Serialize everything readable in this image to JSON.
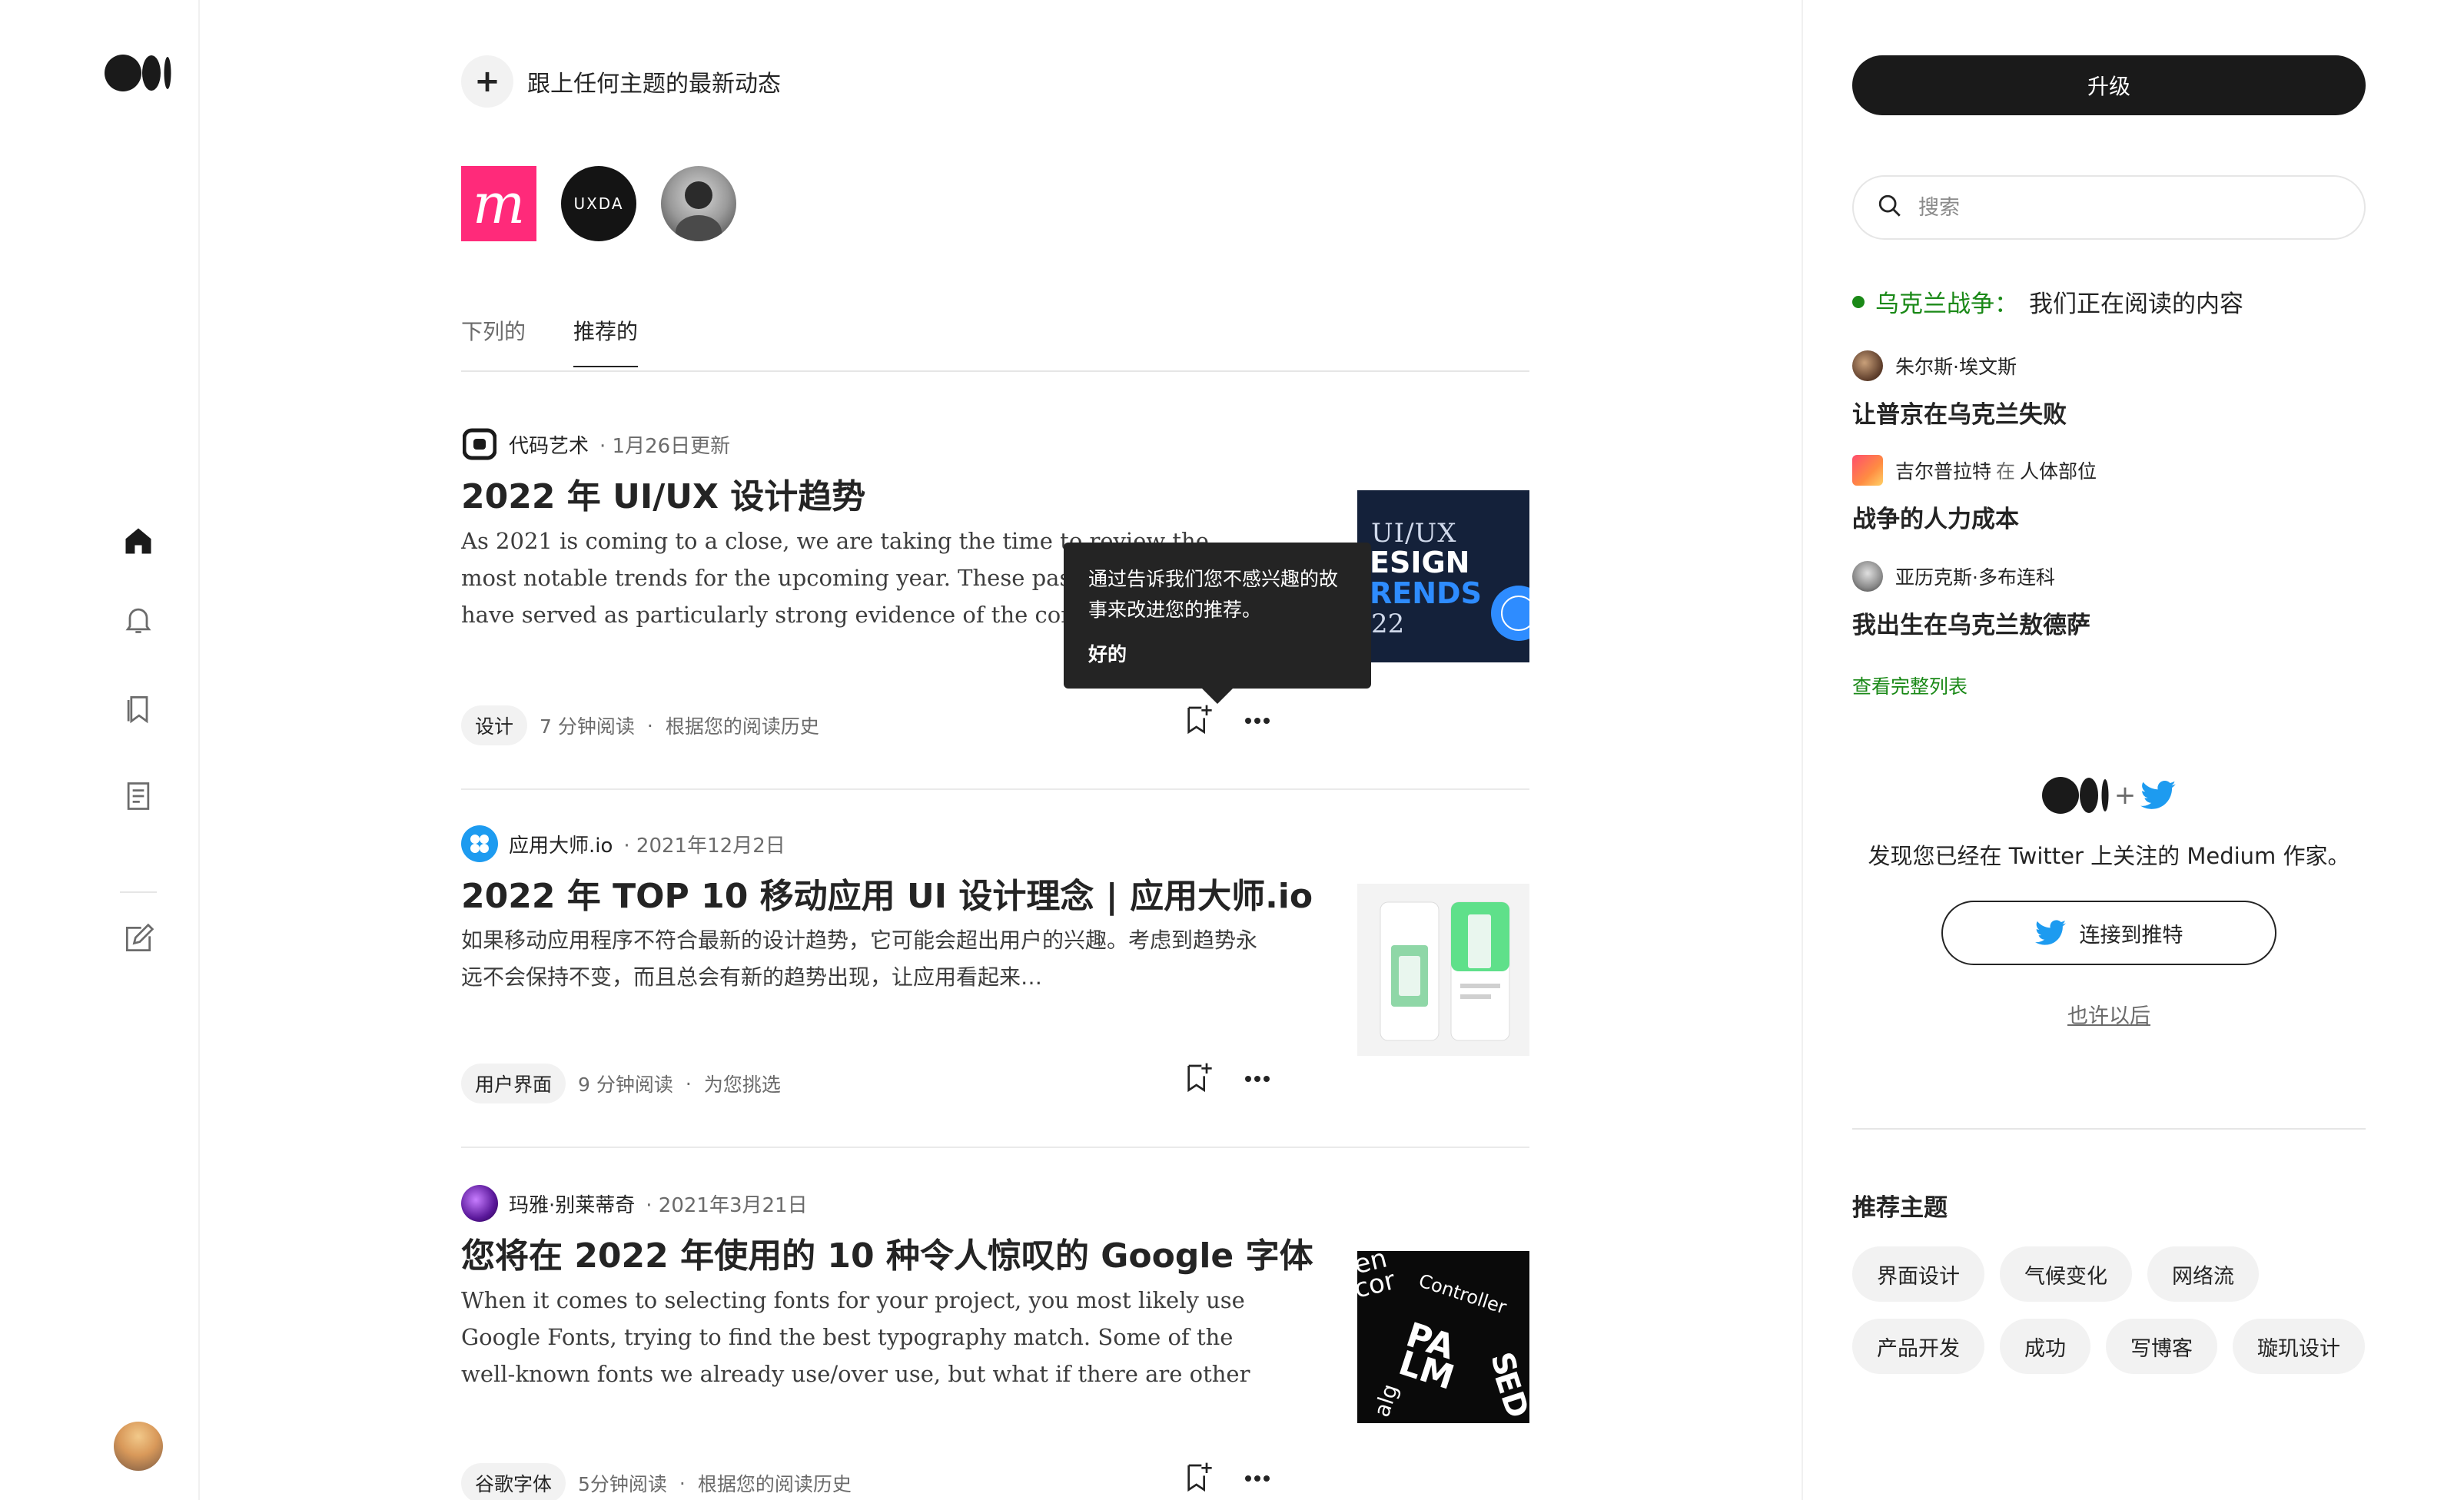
{
  "follow_prompt": "跟上任何主题的最新动态",
  "follow_plus": "+",
  "follow_avatars": [
    "m",
    "UXDA",
    "person"
  ],
  "tabs": [
    {
      "label": "下列的",
      "active": false
    },
    {
      "label": "推荐的",
      "active": true
    }
  ],
  "articles": [
    {
      "publication": "代码艺术",
      "date": "· 1月26日更新",
      "title": "2022 年 UI/UX 设计趋势",
      "excerpt": "As 2021 is coming to a close, we are taking the time to review the most notable trends for the upcoming year. These past couple of years have served as particularly strong evidence of the constant and fast development…",
      "tag": "设计",
      "read_time": "7 分钟阅读",
      "reason": "根据您的阅读历史",
      "thumb_text": [
        "UI/UX",
        "ESIGN",
        "RENDS",
        "22"
      ]
    },
    {
      "publication": "应用大师.io",
      "date": "· 2021年12月2日",
      "title": "2022 年 TOP 10 移动应用 UI 设计理念 | 应用大师.io",
      "excerpt": "如果移动应用程序不符合最新的设计趋势，它可能会超出用户的兴趣。考虑到趋势永远不会保持不变，而且总会有新的趋势出现，让应用看起来…",
      "tag": "用户界面",
      "read_time": "9 分钟阅读",
      "reason": "为您挑选"
    },
    {
      "publication": "玛雅·别莱蒂奇",
      "date": "· 2021年3月21日",
      "title": "您将在 2022 年使用的 10 种令人惊叹的 Google 字体",
      "excerpt": "When it comes to selecting fonts for your project, you most likely use Google Fonts, trying to find the best typography match. Some of the well-known fonts we already use/over use, but what if there are other cool fon…",
      "tag": "谷歌字体",
      "read_time": "5分钟阅读",
      "reason": "根据您的阅读历史",
      "thumb_text": [
        "en",
        "cor",
        "Controller",
        "PA",
        "LM",
        "S",
        "ED",
        "alg"
      ]
    }
  ],
  "tooltip": {
    "text": "通过告诉我们您不感兴趣的故事来改进您的推荐。",
    "ok": "好的"
  },
  "sidebar": {
    "upgrade": "升级",
    "search_placeholder": "搜索",
    "news_topic": "乌克兰战争：",
    "news_rest": "我们正在阅读的内容",
    "news": [
      {
        "author": "朱尔斯·埃文斯",
        "in": "",
        "publication": "",
        "title": "让普京在乌克兰失败"
      },
      {
        "author": "吉尔普拉特",
        "in": "在",
        "publication": "人体部位",
        "title": "战争的人力成本"
      },
      {
        "author": "亚历克斯·多布连科",
        "in": "",
        "publication": "",
        "title": "我出生在乌克兰敖德萨"
      }
    ],
    "see_all": "查看完整列表",
    "twitter_plus": "+",
    "twitter_text": "发现您已经在 Twitter 上关注的 Medium 作家。",
    "twitter_button": "连接到推特",
    "maybe_later": "也许以后",
    "topics_title": "推荐主题",
    "topics": [
      "界面设计",
      "气候变化",
      "网络流",
      "产品开发",
      "成功",
      "写博客",
      "璇玑设计"
    ]
  },
  "colors": {
    "accent_green": "#1a8917",
    "text": "#242424",
    "muted": "#6b6b6b",
    "twitter_blue": "#1d9bf0",
    "brand_pink": "#ff2a7a"
  }
}
